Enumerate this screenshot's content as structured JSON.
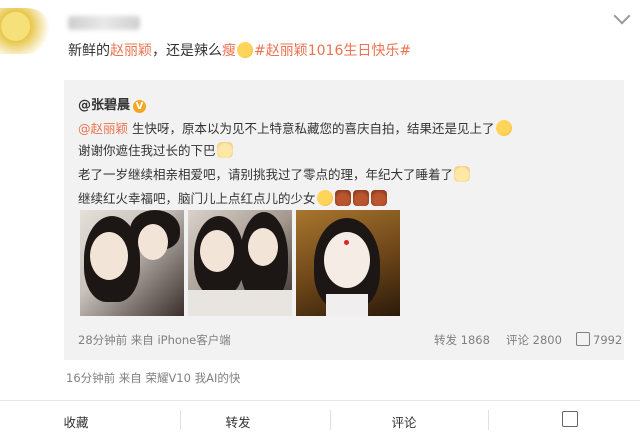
{
  "post": {
    "text_plain": "新鲜的",
    "mention": "赵丽颖",
    "text_mid": "，还是辣么",
    "text_red": "瘦",
    "hashtag": "#赵丽颖1016生日快乐#"
  },
  "repost": {
    "author": "@张碧晨",
    "lines": [
      {
        "mention": "@赵丽颖",
        "text": " 生快呀，原本以为见不上特意私藏您的喜庆自拍，结果还是见上了"
      },
      {
        "text": "谢谢你遮住我过长的下巴"
      },
      {
        "text": "老了一岁继续相亲相爱吧，请别挑我过了零点的理，年纪大了睡着了"
      },
      {
        "text": "继续红火幸福吧，脑门儿上点红点儿的少女"
      }
    ],
    "meta": "28分钟前 来自 iPhone客户端",
    "reposts": "转发 1868",
    "comments": "评论 2800",
    "likes": "7992"
  },
  "footer_meta": "16分钟前 来自 荣耀V10 我AI的快",
  "actions": {
    "favorite": "收藏",
    "repost": "转发",
    "comment": "评论"
  },
  "colors": {
    "link": "#eb7350",
    "meta": "#808080",
    "card_bg": "#f2f2f2"
  },
  "icons": [
    "chevron-down-icon",
    "verified-badge-icon",
    "emoji-face-icon",
    "emoji-cake-icon",
    "emoji-cat-icon",
    "like-icon"
  ]
}
